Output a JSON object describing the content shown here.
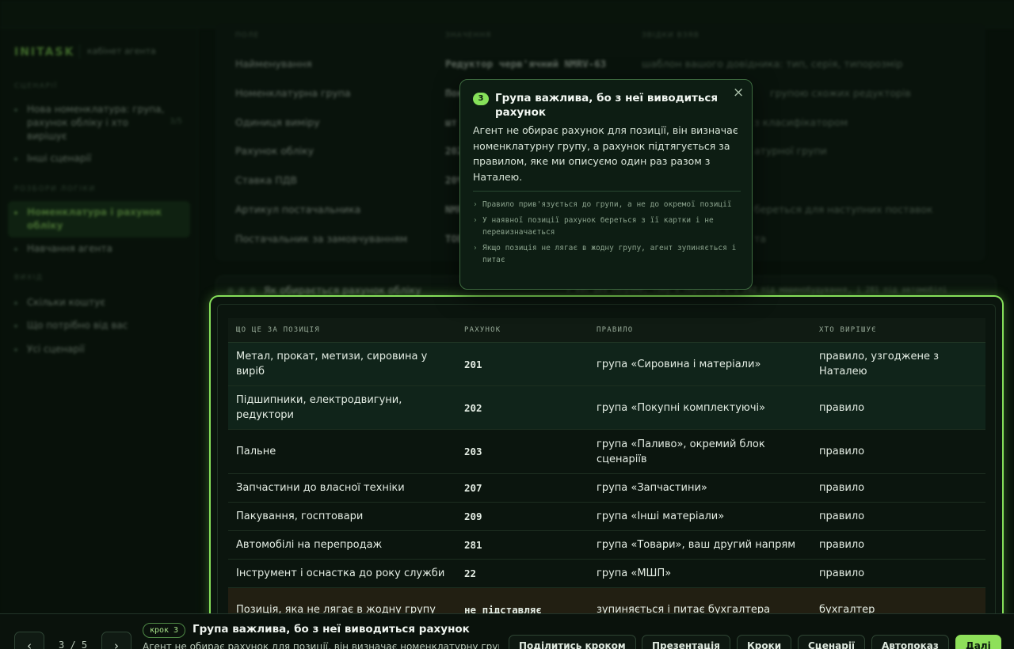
{
  "app": {
    "logo": "INITASK",
    "subtitle": "кабінет агента"
  },
  "sidebar": {
    "sections": [
      {
        "title": "СЦЕНАРІЇ",
        "items": [
          "Нова номенклатура: група, рахунок обліку і хто вирішує",
          "Інші сценарії"
        ]
      },
      {
        "title": "РОЗБОРИ ЛОГІКИ",
        "items": [
          "Номенклатура і рахунок обліку",
          "Навчання агента"
        ]
      },
      {
        "title": "ВИХІД",
        "items": [
          "Скільки коштує",
          "Що потрібно від вас",
          "Усі сценарії"
        ]
      }
    ],
    "item_count": "3/5"
  },
  "bg_table": {
    "headers": [
      "ПОЛЕ",
      "ЗНАЧЕННЯ",
      "ЗВІДКИ ВЗЯВ"
    ],
    "rows": [
      {
        "field": "Найменування",
        "value": "Редуктор черв'ячний NMRV-63",
        "source": "шаблон вашого довідника: тип, серія, типорозмір"
      },
      {
        "field": "Номенклатурна група",
        "value": "Пок",
        "source": "групою схожих редукторів"
      },
      {
        "field": "Одиниця виміру",
        "value": "шт",
        "source": "з класифікатором"
      },
      {
        "field": "Рахунок обліку",
        "value": "202",
        "source": "атурної групи"
      },
      {
        "field": "Ставка ПДВ",
        "value": "20%",
        "source": ""
      },
      {
        "field": "Артикул постачальника",
        "value": "NMR",
        "source": "береться для наступних поставок"
      },
      {
        "field": "Постачальник за замовчуванням",
        "value": "ТОВ",
        "source": "та"
      }
    ]
  },
  "card": {
    "title": "Як обирається рахунок обліку",
    "note": "У вас два напрями, тому в переліку є і 202 під машинобудування, і 281 під автомобілі"
  },
  "table": {
    "headers": [
      "ЩО ЦЕ ЗА ПОЗИЦІЯ",
      "РАХУНОК",
      "ПРАВИЛО",
      "ХТО ВИРІШУЄ"
    ],
    "rows": [
      {
        "item": "Метал, прокат, метизи, сировина у виріб",
        "account": "201",
        "rule": "група «Сировина і матеріали»",
        "who": "правило, узгоджене з Наталею"
      },
      {
        "item": "Підшипники, електродвигуни, редуктори",
        "account": "202",
        "rule": "група «Покупні комплектуючі»",
        "who": "правило"
      },
      {
        "item": "Пальне",
        "account": "203",
        "rule": "група «Паливо», окремий блок сценаріїв",
        "who": "правило"
      },
      {
        "item": "Запчастини до власної техніки",
        "account": "207",
        "rule": "група «Запчастини»",
        "who": "правило"
      },
      {
        "item": "Пакування, госптовари",
        "account": "209",
        "rule": "група «Інші матеріали»",
        "who": "правило"
      },
      {
        "item": "Автомобілі на перепродаж",
        "account": "281",
        "rule": "група «Товари», ваш другий напрям",
        "who": "правило"
      },
      {
        "item": "Інструмент і оснастка до року служби",
        "account": "22",
        "rule": "група «МШП»",
        "who": "правило"
      },
      {
        "item": "Позиція, яка не лягає в жодну групу",
        "account": "не підставляє",
        "rule": "зупиняється і питає бухгалтера",
        "who": "бухгалтер"
      }
    ]
  },
  "popover": {
    "step": "3",
    "title": "Група важлива, бо з неї виводиться рахунок",
    "close_icon": "×",
    "body": "Агент не обирає рахунок для позиції, він визначає номенклатурну групу, а рахунок підтягується за правилом, яке ми описуємо один раз разом з Наталею.",
    "bullets": [
      "Правило прив'язується до групи, а не до окремої позиції",
      "У наявної позиції рахунок береться з її картки і не перевизначається",
      "Якщо позиція не лягає в жодну групу, агент зупиняється і питає"
    ]
  },
  "bottom": {
    "prev": "‹",
    "next": "›",
    "pager": "3 / 5",
    "step_badge": "крок 3",
    "step_title": "Група важлива, бо з неї виводиться рахунок",
    "step_desc": "Агент не обирає рахунок для позиції, він визначає номенклатурну групу, а рахунок підтягується за правилом",
    "buttons": {
      "share": "Поділитись кроком",
      "present": "Презентація",
      "steps": "Кроки",
      "scenarios": "Сценарії",
      "autoplay": "Автопоказ",
      "next": "Далі"
    }
  }
}
